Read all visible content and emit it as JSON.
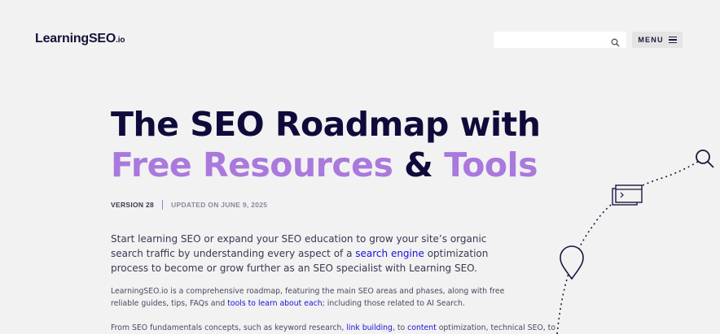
{
  "header": {
    "logo_main": "LearningSEO",
    "logo_tld": ".io",
    "search_placeholder": "",
    "menu_label": "MENU"
  },
  "hero": {
    "title_line1": "The SEO Roadmap with",
    "title_purple1": "Free Resources",
    "title_amp": " & ",
    "title_purple2": "Tools",
    "version": "VERSION 28",
    "updated": "UPDATED ON JUNE 9, 2025"
  },
  "intro": {
    "before_link": "Start learning SEO or expand your SEO education to grow your site’s organic search traffic by understanding every aspect of a ",
    "link": "search engine",
    "after_link": " optimization process to become or grow further as an SEO specialist with Learning SEO."
  },
  "para2": {
    "before_link": "LearningSEO.io is a comprehensive roadmap, featuring the main SEO areas and phases, along with free reliable guides, tips, FAQs and ",
    "link": "tools to learn about each",
    "after_link": "; including those related to AI Search."
  },
  "para3": {
    "before_link1": "From SEO fundamentals concepts, such as keyword research, ",
    "link1": "link building",
    "between": ", to ",
    "link2": "content",
    "after_link2": " optimization, technical SEO, to"
  },
  "colors": {
    "background": "#f2f2f2",
    "title": "#0e0b3a",
    "accent_purple": "#a979dd",
    "link": "#1a12d6"
  },
  "icons": [
    "search-icon",
    "hamburger-icon",
    "magnifier-icon",
    "browser-window-icon",
    "location-pin-icon"
  ]
}
